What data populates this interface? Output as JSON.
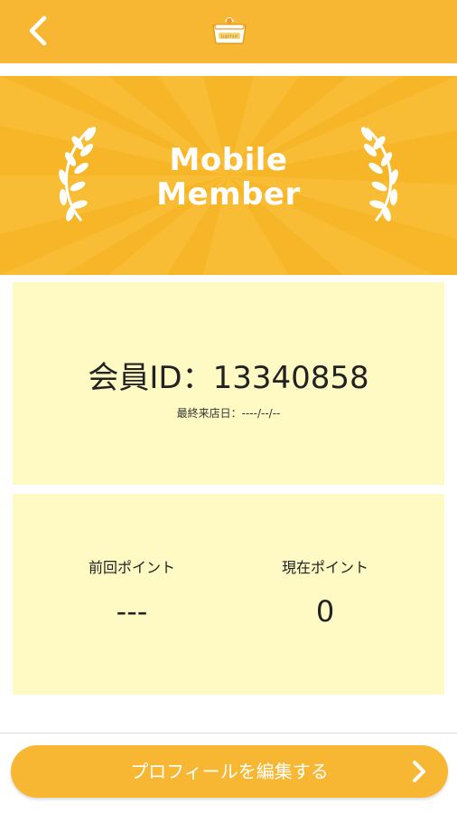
{
  "header": {
    "back_icon": "chevron-left-icon",
    "logo_icon": "store-basket-logo",
    "logo_text": "Lupinus"
  },
  "banner": {
    "title_line1": "Mobile",
    "title_line2": "Member",
    "decor_icon": "laurel-wreath-icon"
  },
  "member": {
    "id_label": "会員ID：13340858",
    "last_visit": "最終来店日：----/--/--"
  },
  "points": {
    "previous_label": "前回ポイント",
    "previous_value": "---",
    "current_label": "現在ポイント",
    "current_value": "0"
  },
  "actions": {
    "edit_profile": "プロフィールを編集する",
    "edit_profile_icon": "chevron-right-icon"
  },
  "colors": {
    "accent": "#f7b733",
    "banner": "#f8bd35",
    "panel": "#fff9c4",
    "text": "#222222"
  }
}
